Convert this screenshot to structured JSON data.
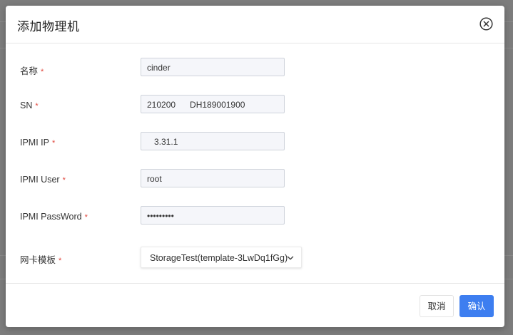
{
  "dialog": {
    "title": "添加物理机"
  },
  "form": {
    "name": {
      "label": "名称",
      "required": "*",
      "value": "cinder"
    },
    "sn": {
      "label": "SN",
      "required": "*",
      "value": "210200      DH189001900"
    },
    "ipmi_ip": {
      "label": "IPMI IP",
      "required": "*",
      "value": "   3.31.1       "
    },
    "ipmi_user": {
      "label": "IPMI User",
      "required": "*",
      "value": "root"
    },
    "ipmi_password": {
      "label": "IPMI PassWord",
      "required": "*",
      "value": "•••••••••"
    },
    "nic_template": {
      "label": "网卡模板",
      "required": "*",
      "value": "StorageTest(template-3LwDq1fGg)"
    }
  },
  "footer": {
    "cancel_label": "取消",
    "ok_label": "确认"
  },
  "colors": {
    "primary": "#3d7ef0",
    "required": "#e0443a"
  }
}
